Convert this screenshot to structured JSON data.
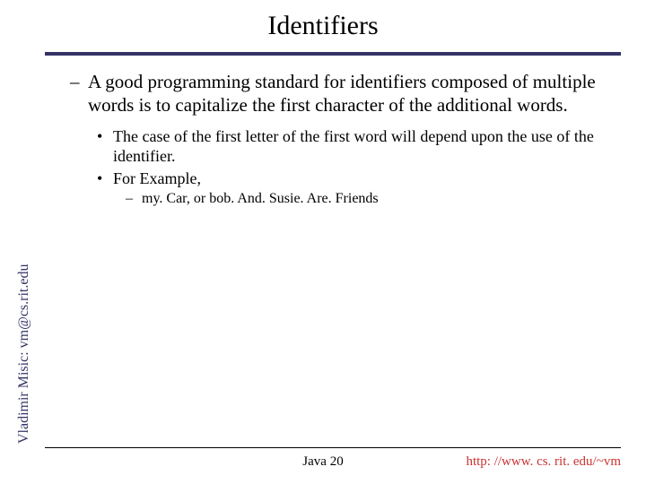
{
  "title": "Identifiers",
  "bullets": {
    "main": "A good programming standard for identifiers composed of multiple words is to capitalize the first character of the additional words.",
    "sub1": "The case of the first letter of the first word will depend upon the use of the identifier.",
    "sub2": "For Example,",
    "example": "my. Car, or bob. And. Susie. Are. Friends"
  },
  "sidebar": "Vladimir Misic: vm@cs.rit.edu",
  "footer": {
    "center": "Java 20",
    "right": "http: //www. cs. rit. edu/~vm"
  }
}
